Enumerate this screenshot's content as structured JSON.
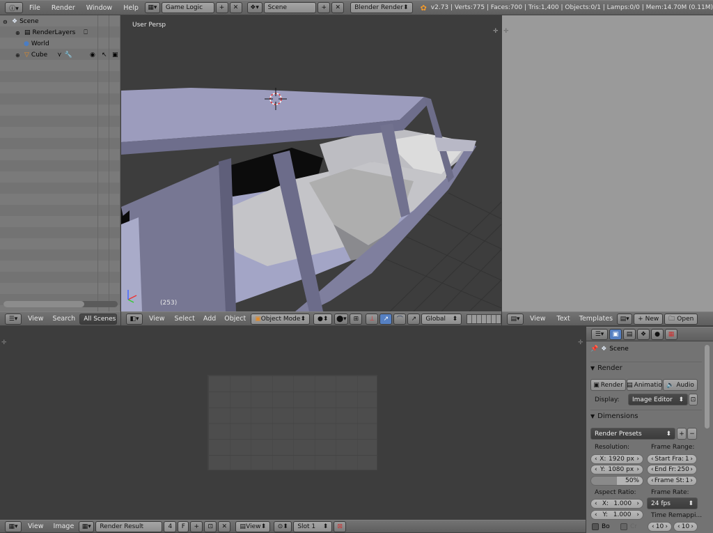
{
  "top_bar": {
    "menus": [
      "File",
      "Render",
      "Window",
      "Help"
    ],
    "layout": "Game Logic",
    "scene": "Scene",
    "engine": "Blender Render",
    "stats": "v2.73 | Verts:775 | Faces:700 | Tris:1,400 | Objects:0/1 | Lamps:0/0 | Mem:14.70M (0.11M)"
  },
  "outliner": {
    "items": [
      {
        "label": "Scene"
      },
      {
        "label": "RenderLayers"
      },
      {
        "label": "World"
      },
      {
        "label": "Cube"
      }
    ],
    "header": {
      "view": "View",
      "search": "Search",
      "scenes": "All Scenes"
    }
  },
  "viewport": {
    "label": "User Persp",
    "frame": "(253)",
    "header": {
      "view": "View",
      "select": "Select",
      "add": "Add",
      "object": "Object",
      "mode": "Object Mode",
      "orientation": "Global"
    }
  },
  "text_editor": {
    "header": {
      "view": "View",
      "text": "Text",
      "templates": "Templates",
      "new": "New",
      "open": "Open"
    }
  },
  "image_editor": {
    "header": {
      "view": "View",
      "image": "Image",
      "image_name": "Render Result",
      "users": "4",
      "fake": "F",
      "view_menu": "View",
      "slot": "Slot 1"
    }
  },
  "properties": {
    "context": "Scene",
    "render": {
      "title": "Render",
      "btn_render": "Render",
      "btn_animation": "Animatio",
      "btn_audio": "Audio",
      "display_label": "Display:",
      "display_value": "Image Editor"
    },
    "dimensions": {
      "title": "Dimensions",
      "presets": "Render Presets",
      "resolution_label": "Resolution:",
      "res_x_label": "X:",
      "res_x": "1920 px",
      "res_y_label": "Y:",
      "res_y": "1080 px",
      "res_pct": "50%",
      "frame_range_label": "Frame Range:",
      "start_label": "Start Fra:",
      "start": "1",
      "end_label": "End Fr:",
      "end": "250",
      "step_label": "Frame St:",
      "step": "1",
      "aspect_label": "Aspect Ratio:",
      "asp_x_label": "X:",
      "asp_x": "1.000",
      "asp_y_label": "Y:",
      "asp_y": "1.000",
      "frame_rate_label": "Frame Rate:",
      "fps": "24 fps",
      "time_remap_label": "Time Remappi...",
      "border_label": "Bo",
      "crop_label": "Cr",
      "remap_old": "10",
      "remap_new": "10"
    }
  }
}
